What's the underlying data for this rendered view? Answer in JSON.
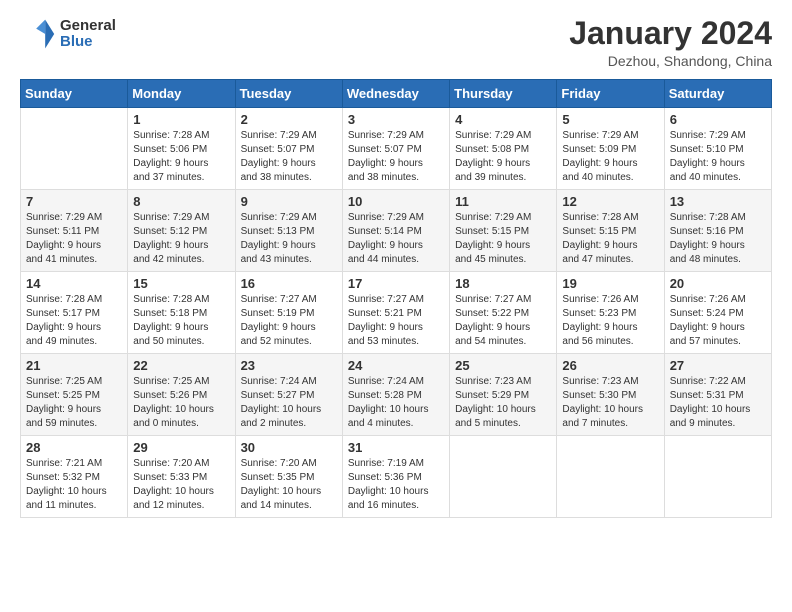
{
  "header": {
    "logo": {
      "general": "General",
      "blue": "Blue"
    },
    "title": "January 2024",
    "location": "Dezhou, Shandong, China"
  },
  "days_of_week": [
    "Sunday",
    "Monday",
    "Tuesday",
    "Wednesday",
    "Thursday",
    "Friday",
    "Saturday"
  ],
  "weeks": [
    [
      {
        "day": "",
        "info": ""
      },
      {
        "day": "1",
        "info": "Sunrise: 7:28 AM\nSunset: 5:06 PM\nDaylight: 9 hours\nand 37 minutes."
      },
      {
        "day": "2",
        "info": "Sunrise: 7:29 AM\nSunset: 5:07 PM\nDaylight: 9 hours\nand 38 minutes."
      },
      {
        "day": "3",
        "info": "Sunrise: 7:29 AM\nSunset: 5:07 PM\nDaylight: 9 hours\nand 38 minutes."
      },
      {
        "day": "4",
        "info": "Sunrise: 7:29 AM\nSunset: 5:08 PM\nDaylight: 9 hours\nand 39 minutes."
      },
      {
        "day": "5",
        "info": "Sunrise: 7:29 AM\nSunset: 5:09 PM\nDaylight: 9 hours\nand 40 minutes."
      },
      {
        "day": "6",
        "info": "Sunrise: 7:29 AM\nSunset: 5:10 PM\nDaylight: 9 hours\nand 40 minutes."
      }
    ],
    [
      {
        "day": "7",
        "info": "Sunrise: 7:29 AM\nSunset: 5:11 PM\nDaylight: 9 hours\nand 41 minutes."
      },
      {
        "day": "8",
        "info": "Sunrise: 7:29 AM\nSunset: 5:12 PM\nDaylight: 9 hours\nand 42 minutes."
      },
      {
        "day": "9",
        "info": "Sunrise: 7:29 AM\nSunset: 5:13 PM\nDaylight: 9 hours\nand 43 minutes."
      },
      {
        "day": "10",
        "info": "Sunrise: 7:29 AM\nSunset: 5:14 PM\nDaylight: 9 hours\nand 44 minutes."
      },
      {
        "day": "11",
        "info": "Sunrise: 7:29 AM\nSunset: 5:15 PM\nDaylight: 9 hours\nand 45 minutes."
      },
      {
        "day": "12",
        "info": "Sunrise: 7:28 AM\nSunset: 5:15 PM\nDaylight: 9 hours\nand 47 minutes."
      },
      {
        "day": "13",
        "info": "Sunrise: 7:28 AM\nSunset: 5:16 PM\nDaylight: 9 hours\nand 48 minutes."
      }
    ],
    [
      {
        "day": "14",
        "info": "Sunrise: 7:28 AM\nSunset: 5:17 PM\nDaylight: 9 hours\nand 49 minutes."
      },
      {
        "day": "15",
        "info": "Sunrise: 7:28 AM\nSunset: 5:18 PM\nDaylight: 9 hours\nand 50 minutes."
      },
      {
        "day": "16",
        "info": "Sunrise: 7:27 AM\nSunset: 5:19 PM\nDaylight: 9 hours\nand 52 minutes."
      },
      {
        "day": "17",
        "info": "Sunrise: 7:27 AM\nSunset: 5:21 PM\nDaylight: 9 hours\nand 53 minutes."
      },
      {
        "day": "18",
        "info": "Sunrise: 7:27 AM\nSunset: 5:22 PM\nDaylight: 9 hours\nand 54 minutes."
      },
      {
        "day": "19",
        "info": "Sunrise: 7:26 AM\nSunset: 5:23 PM\nDaylight: 9 hours\nand 56 minutes."
      },
      {
        "day": "20",
        "info": "Sunrise: 7:26 AM\nSunset: 5:24 PM\nDaylight: 9 hours\nand 57 minutes."
      }
    ],
    [
      {
        "day": "21",
        "info": "Sunrise: 7:25 AM\nSunset: 5:25 PM\nDaylight: 9 hours\nand 59 minutes."
      },
      {
        "day": "22",
        "info": "Sunrise: 7:25 AM\nSunset: 5:26 PM\nDaylight: 10 hours\nand 0 minutes."
      },
      {
        "day": "23",
        "info": "Sunrise: 7:24 AM\nSunset: 5:27 PM\nDaylight: 10 hours\nand 2 minutes."
      },
      {
        "day": "24",
        "info": "Sunrise: 7:24 AM\nSunset: 5:28 PM\nDaylight: 10 hours\nand 4 minutes."
      },
      {
        "day": "25",
        "info": "Sunrise: 7:23 AM\nSunset: 5:29 PM\nDaylight: 10 hours\nand 5 minutes."
      },
      {
        "day": "26",
        "info": "Sunrise: 7:23 AM\nSunset: 5:30 PM\nDaylight: 10 hours\nand 7 minutes."
      },
      {
        "day": "27",
        "info": "Sunrise: 7:22 AM\nSunset: 5:31 PM\nDaylight: 10 hours\nand 9 minutes."
      }
    ],
    [
      {
        "day": "28",
        "info": "Sunrise: 7:21 AM\nSunset: 5:32 PM\nDaylight: 10 hours\nand 11 minutes."
      },
      {
        "day": "29",
        "info": "Sunrise: 7:20 AM\nSunset: 5:33 PM\nDaylight: 10 hours\nand 12 minutes."
      },
      {
        "day": "30",
        "info": "Sunrise: 7:20 AM\nSunset: 5:35 PM\nDaylight: 10 hours\nand 14 minutes."
      },
      {
        "day": "31",
        "info": "Sunrise: 7:19 AM\nSunset: 5:36 PM\nDaylight: 10 hours\nand 16 minutes."
      },
      {
        "day": "",
        "info": ""
      },
      {
        "day": "",
        "info": ""
      },
      {
        "day": "",
        "info": ""
      }
    ]
  ]
}
